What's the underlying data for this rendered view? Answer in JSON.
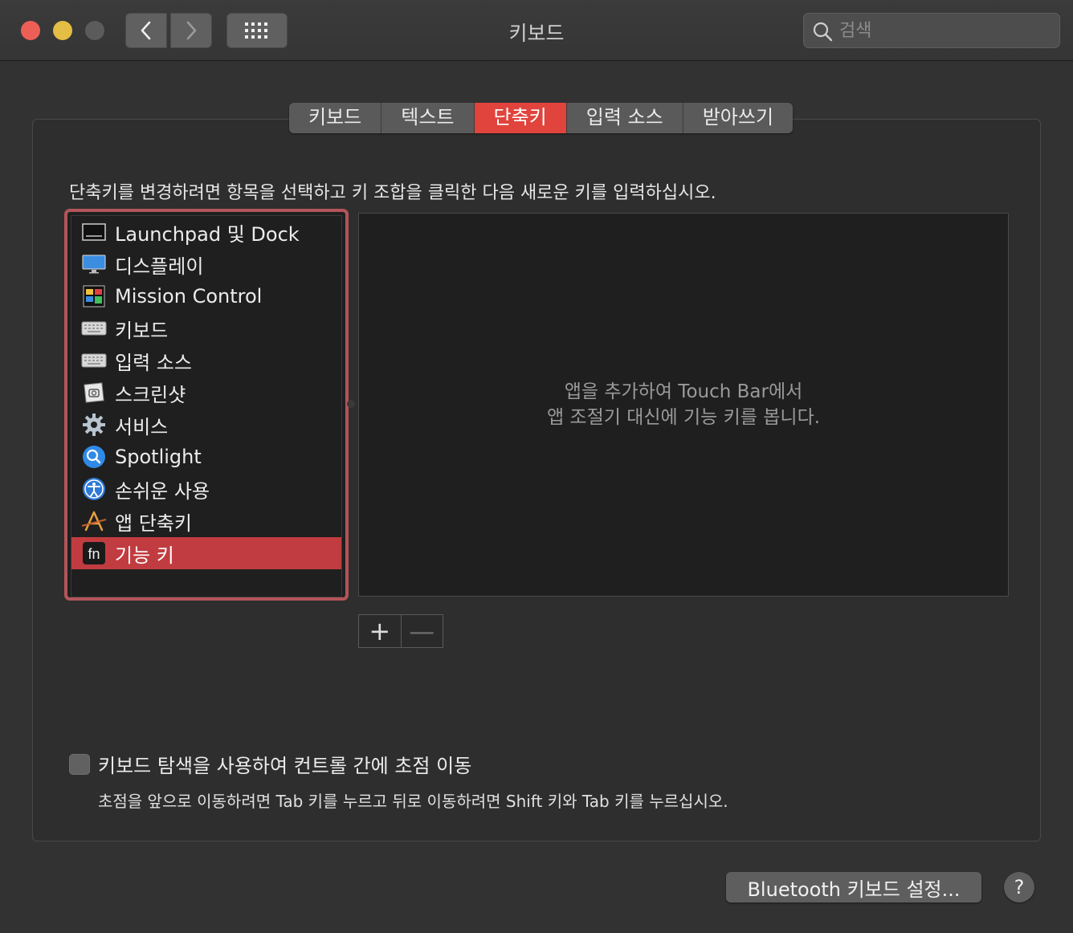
{
  "window": {
    "title": "키보드"
  },
  "search": {
    "placeholder": "검색"
  },
  "tabs": [
    {
      "label": "키보드"
    },
    {
      "label": "텍스트"
    },
    {
      "label": "단축키",
      "active": true
    },
    {
      "label": "입력 소스"
    },
    {
      "label": "받아쓰기"
    }
  ],
  "instruction": "단축키를 변경하려면 항목을 선택하고 키 조합을 클릭한 다음 새로운 키를 입력하십시오.",
  "categories": [
    {
      "label": "Launchpad 및 Dock",
      "icon": "launchpad-dock-icon"
    },
    {
      "label": "디스플레이",
      "icon": "display-icon"
    },
    {
      "label": "Mission Control",
      "icon": "mission-control-icon"
    },
    {
      "label": "키보드",
      "icon": "keyboard-icon"
    },
    {
      "label": "입력 소스",
      "icon": "input-source-icon"
    },
    {
      "label": "스크린샷",
      "icon": "screenshot-icon"
    },
    {
      "label": "서비스",
      "icon": "gear-icon"
    },
    {
      "label": "Spotlight",
      "icon": "spotlight-icon"
    },
    {
      "label": "손쉬운 사용",
      "icon": "accessibility-icon"
    },
    {
      "label": "앱 단축키",
      "icon": "app-shortcuts-icon"
    },
    {
      "label": "기능 키",
      "icon": "fn-key-icon",
      "selected": true
    }
  ],
  "detail": {
    "line1": "앱을 추가하여 Touch Bar에서",
    "line2": "앱 조절기 대신에 기능 키를 봅니다."
  },
  "buttons": {
    "add": "+",
    "remove": "—",
    "bluetooth": "Bluetooth 키보드 설정...",
    "help": "?"
  },
  "keyboard_nav": {
    "label": "키보드 탐색을 사용하여 컨트롤 간에 초점 이동",
    "checked": false,
    "hint": "초점을 앞으로 이동하려면 Tab 키를 누르고 뒤로 이동하려면 Shift 키와 Tab 키를 누르십시오."
  },
  "colors": {
    "accent": "#e0443c",
    "selection": "#c13c40",
    "focus_ring": "#b3555a"
  }
}
